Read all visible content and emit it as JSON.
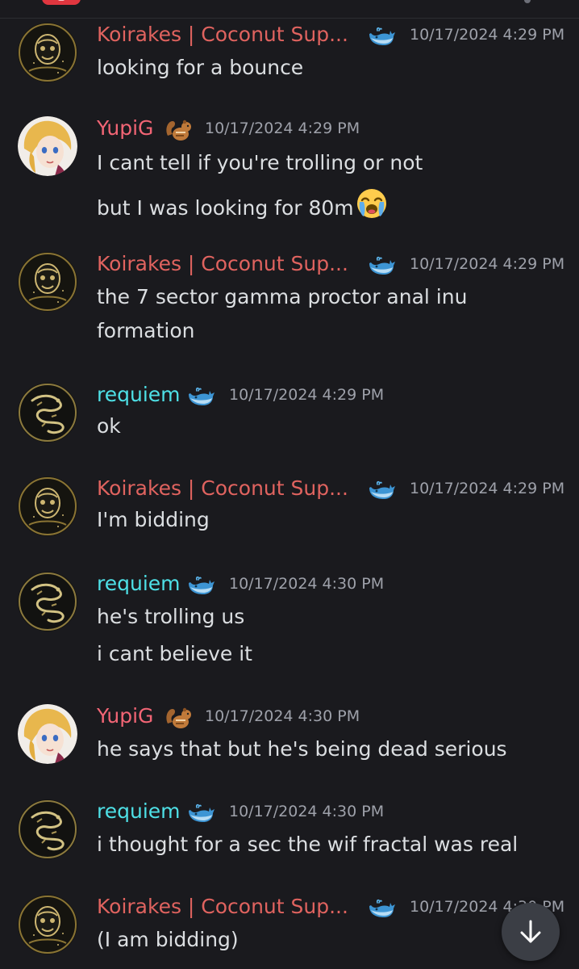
{
  "messages": [
    {
      "author": "Koirakes | Coconut Sup...",
      "time": "10/17/2024 4:29 PM",
      "lines": [
        "looking for a bounce"
      ]
    },
    {
      "author": "YupiG",
      "time": "10/17/2024 4:29 PM",
      "lines": [
        "I cant tell if you're trolling or not",
        "but I was looking for 80m"
      ]
    },
    {
      "author": "Koirakes | Coconut Sup...",
      "time": "10/17/2024 4:29 PM",
      "lines": [
        "the 7 sector gamma proctor anal inu",
        "formation"
      ]
    },
    {
      "author": "requiem",
      "time": "10/17/2024 4:29 PM",
      "lines": [
        "ok"
      ]
    },
    {
      "author": "Koirakes | Coconut Sup...",
      "time": "10/17/2024 4:29 PM",
      "lines": [
        "I'm bidding"
      ]
    },
    {
      "author": "requiem",
      "time": "10/17/2024 4:30 PM",
      "lines": [
        "he's trolling us",
        "i cant believe it"
      ]
    },
    {
      "author": "YupiG",
      "time": "10/17/2024 4:30 PM",
      "lines": [
        "he says that but he's being dead serious"
      ]
    },
    {
      "author": "requiem",
      "time": "10/17/2024 4:30 PM",
      "lines": [
        "i thought for a sec the wif fractal was real"
      ]
    },
    {
      "author": "Koirakes | Coconut Sup...",
      "time": "10/17/2024 4:30 PM",
      "lines": [
        "(I am bidding)"
      ]
    }
  ],
  "icons": {
    "whale_badge": "whale-icon",
    "chipmunk_badge": "chipmunk-icon",
    "crying_emoji": "loudly-crying-face-icon",
    "scroll_down": "arrow-down-icon"
  },
  "colors": {
    "background": "#1a1a1e",
    "koirakes_name": "#e0635f",
    "requiem_name": "#4ee0e6",
    "yupig_name": "#f26575",
    "timestamp": "#9ea1aa",
    "message_text": "#dbdee1"
  }
}
